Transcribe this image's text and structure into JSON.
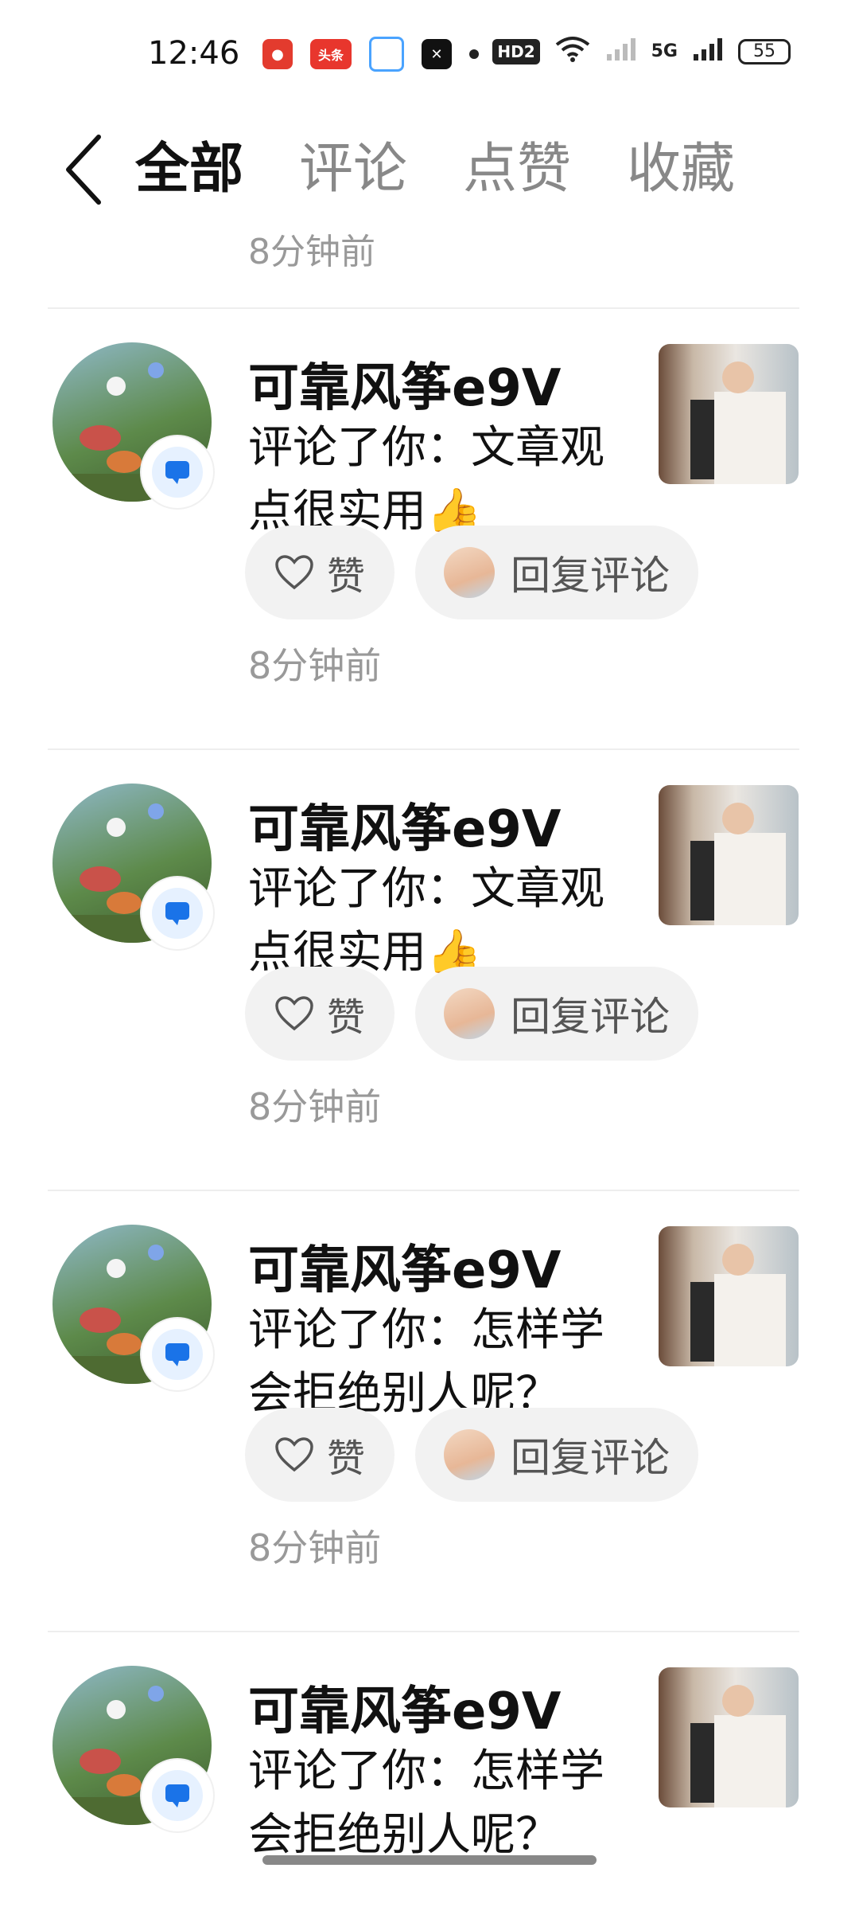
{
  "status_bar": {
    "time": "12:46",
    "app_icons": [
      "weibo-icon",
      "toutiao-icon",
      "app-icon",
      "capcut-icon"
    ],
    "toutiao_label": "头条",
    "hd_label": "HD2",
    "signal_label": "5G",
    "battery": "55"
  },
  "header": {
    "tabs": [
      {
        "label": "全部",
        "active": true
      },
      {
        "label": "评论",
        "active": false
      },
      {
        "label": "点赞",
        "active": false
      },
      {
        "label": "收藏",
        "active": false
      }
    ]
  },
  "feed": {
    "partial_top_time": "8分钟前",
    "items": [
      {
        "user": "可靠风筝e9V",
        "comment": "评论了你：文章观点很实用👍",
        "like_label": "赞",
        "reply_label": "回复评论",
        "time": "8分钟前"
      },
      {
        "user": "可靠风筝e9V",
        "comment": "评论了你：文章观点很实用👍",
        "like_label": "赞",
        "reply_label": "回复评论",
        "time": "8分钟前"
      },
      {
        "user": "可靠风筝e9V",
        "comment": "评论了你：怎样学会拒绝别人呢？",
        "like_label": "赞",
        "reply_label": "回复评论",
        "time": "8分钟前"
      },
      {
        "user": "可靠风筝e9V",
        "comment": "评论了你：怎样学会拒绝别人呢？",
        "like_label": "赞",
        "reply_label": "回复评论",
        "time": ""
      }
    ]
  },
  "colors": {
    "accent": "#1a73e8",
    "muted": "#999999",
    "chip_bg": "#f2f2f2"
  }
}
